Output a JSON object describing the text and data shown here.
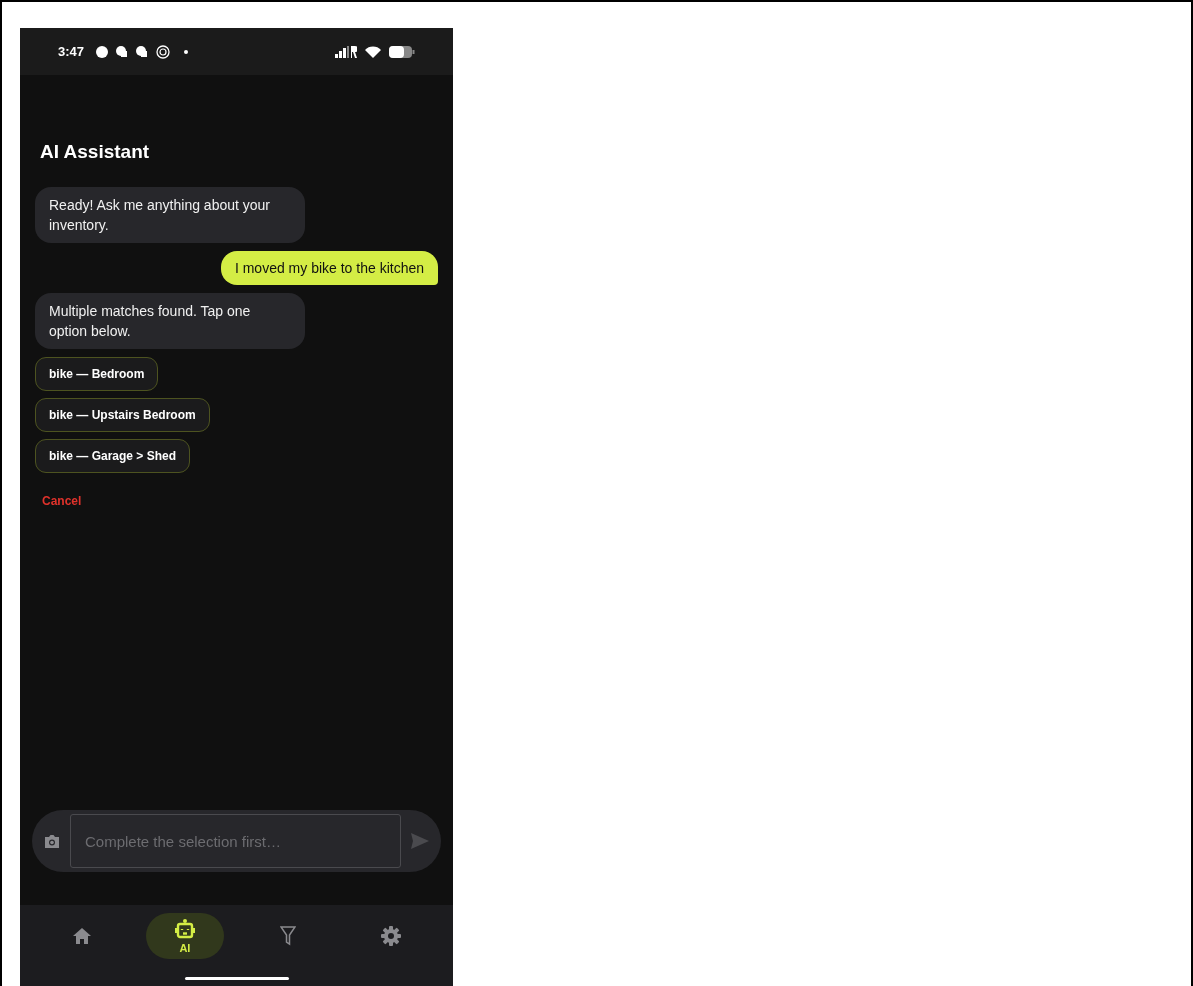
{
  "status_bar": {
    "time": "3:47"
  },
  "header": {
    "title": "AI Assistant"
  },
  "messages": [
    {
      "kind": "bot",
      "text": "Ready! Ask me anything about your inventory."
    },
    {
      "kind": "user",
      "text": "I moved my bike to the kitchen"
    },
    {
      "kind": "bot",
      "text": "Multiple matches found. Tap one option below."
    }
  ],
  "options": [
    "bike — Bedroom",
    "bike — Upstairs Bedroom",
    "bike — Garage > Shed"
  ],
  "cancel": "Cancel",
  "composer": {
    "placeholder": "Complete the selection first…",
    "disabled": true
  },
  "nav": [
    {
      "kind": "home",
      "selected": false
    },
    {
      "kind": "robot",
      "label": "AI",
      "selected": true
    },
    {
      "kind": "filter",
      "selected": false
    },
    {
      "kind": "gear",
      "selected": false
    }
  ]
}
